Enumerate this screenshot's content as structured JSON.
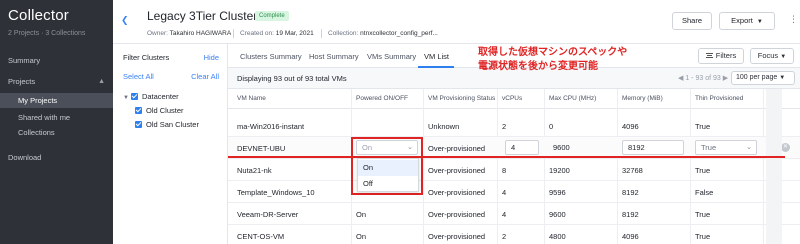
{
  "sidebar": {
    "brand": "Collector",
    "stats": "2 Projects · 3 Collections",
    "items": [
      {
        "label": "Summary"
      },
      {
        "label": "Projects"
      },
      {
        "label": "My Projects"
      },
      {
        "label": "Shared with me"
      },
      {
        "label": "Collections"
      },
      {
        "label": "Download"
      }
    ]
  },
  "header": {
    "back_icon": "chevron-left-icon",
    "title": "Legacy 3Tier Cluster",
    "status_badge": "Complete",
    "owner_label": "Owner:",
    "owner_value": "Takahiro HAGIWARA",
    "created_label": "Created on:",
    "created_value": "19 Mar, 2021",
    "collection_label": "Collection:",
    "collection_value": "ntnxcollector_config_perf...",
    "share_label": "Share",
    "export_label": "Export",
    "more_icon": "vertical-dots-icon"
  },
  "filters": {
    "title": "Filter Clusters",
    "hide_label": "Hide",
    "select_all": "Select All",
    "clear_all": "Clear All",
    "tree": [
      {
        "label": "Datacenter",
        "checked": true
      },
      {
        "label": "Old Cluster",
        "checked": true
      },
      {
        "label": "Old San Cluster",
        "checked": true
      }
    ]
  },
  "tabs": [
    {
      "label": "Clusters Summary"
    },
    {
      "label": "Host Summary"
    },
    {
      "label": "VMs Summary"
    },
    {
      "label": "VM List",
      "active": true
    }
  ],
  "toolbar": {
    "filters_label": "Filters",
    "focus_label": "Focus",
    "count_text": "Displaying 93 out of 93 total VMs",
    "pager_text": "1 - 93 of 93",
    "per_page": "100 per page"
  },
  "table": {
    "columns": [
      "VM Name",
      "Powered ON/OFF",
      "VM Provisioning Status",
      "vCPUs",
      "Max CPU (MHz)",
      "Memory (MiB)",
      "Thin Provisioned"
    ],
    "rows": [
      {
        "name": "ma-Win2016-instant",
        "power": "",
        "status": "Unknown",
        "vcpus": "2",
        "cpu": "0",
        "mem": "4096",
        "thin": "True"
      },
      {
        "name": "DEVNET-UBU",
        "power": "On",
        "status": "Over-provisioned",
        "vcpus": "4",
        "cpu": "9600",
        "mem": "8192",
        "thin": "True",
        "editing": true
      },
      {
        "name": "Nuta21-nk",
        "power": "",
        "status": "Over-provisioned",
        "vcpus": "8",
        "cpu": "19200",
        "mem": "32768",
        "thin": "True"
      },
      {
        "name": "Template_Windows_10",
        "power": "",
        "status": "Over-provisioned",
        "vcpus": "4",
        "cpu": "9596",
        "mem": "8192",
        "thin": "False"
      },
      {
        "name": "Veeam-DR-Server",
        "power": "On",
        "status": "Over-provisioned",
        "vcpus": "4",
        "cpu": "9600",
        "mem": "8192",
        "thin": "True"
      },
      {
        "name": "CENT-OS-VM",
        "power": "On",
        "status": "Over-provisioned",
        "vcpus": "2",
        "cpu": "4800",
        "mem": "4096",
        "thin": "True"
      }
    ]
  },
  "dropdown": {
    "options": [
      "On",
      "Off"
    ]
  },
  "annotation": {
    "line1": "取得した仮想マシンのスペックや",
    "line2": "電源状態を後から変更可能"
  },
  "colors": {
    "accent": "#2f80ed",
    "highlight": "#e02424",
    "sidebar": "#2e3138"
  }
}
